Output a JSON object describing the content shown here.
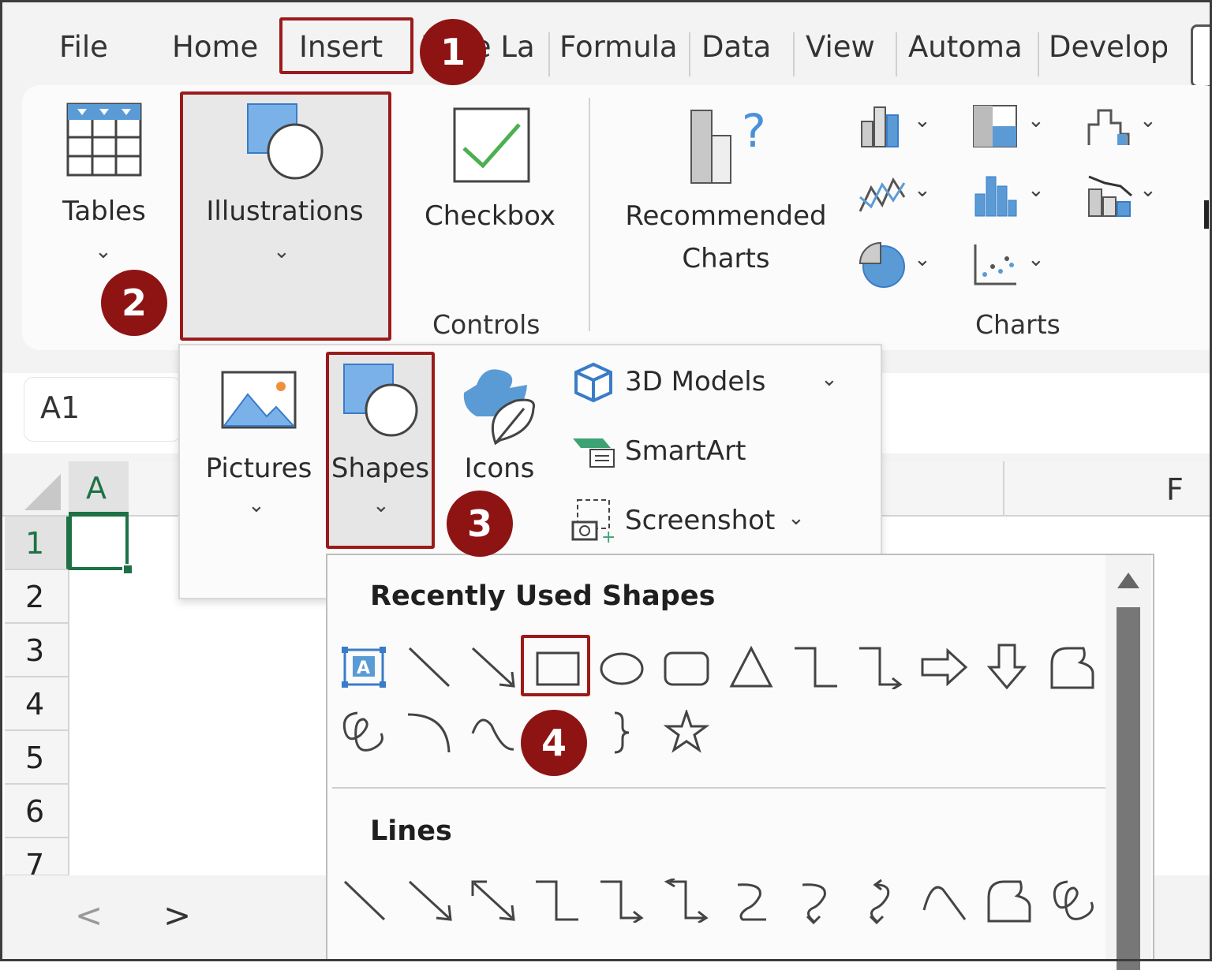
{
  "tabs": [
    "File",
    "Home",
    "Insert",
    "Page La",
    "Formula",
    "Data",
    "View",
    "Automa",
    "Develop"
  ],
  "ribbon": {
    "tables": "Tables",
    "illustrations": "Illustrations",
    "checkbox": "Checkbox",
    "controls": "Controls",
    "recommended_charts_line1": "Recommended",
    "recommended_charts_line2": "Charts",
    "charts": "Charts"
  },
  "illustrations_menu": {
    "pictures": "Pictures",
    "shapes": "Shapes",
    "icons": "Icons",
    "models_3d": "3D Models",
    "smartart": "SmartArt",
    "screenshot": "Screenshot"
  },
  "namebox": "A1",
  "columns": [
    "A",
    "F"
  ],
  "rows": [
    "1",
    "2",
    "3",
    "4",
    "5",
    "6",
    "7"
  ],
  "shapes_gallery": {
    "recently_used": "Recently Used Shapes",
    "lines": "Lines"
  },
  "badges": [
    "1",
    "2",
    "3",
    "4"
  ],
  "nav": {
    "prev": "<",
    "next": ">"
  },
  "colors": {
    "accent_red": "#8e1414",
    "excel_green": "#1e7145",
    "icon_blue": "#5b9bd5"
  }
}
